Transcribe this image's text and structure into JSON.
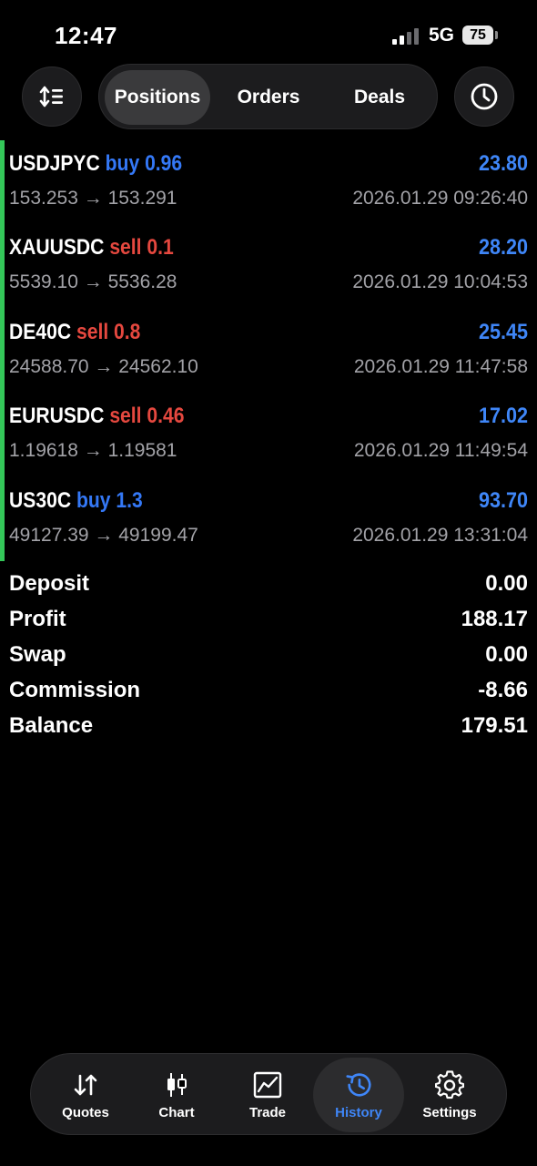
{
  "status_bar": {
    "time": "12:47",
    "network": "5G",
    "battery": "75"
  },
  "header": {
    "sort_icon": "sort-icon",
    "history_icon": "clock-icon",
    "tabs": [
      {
        "label": "Positions",
        "active": true
      },
      {
        "label": "Orders",
        "active": false
      },
      {
        "label": "Deals",
        "active": false
      }
    ]
  },
  "trades": [
    {
      "symbol": "USDJPYC",
      "side": "buy",
      "volume": "0.96",
      "profit": "23.80",
      "prices": "153.253 → 153.291",
      "datetime": "2026.01.29 09:26:40"
    },
    {
      "symbol": "XAUUSDC",
      "side": "sell",
      "volume": "0.1",
      "profit": "28.20",
      "prices": "5539.10 → 5536.28",
      "datetime": "2026.01.29 10:04:53"
    },
    {
      "symbol": "DE40C",
      "side": "sell",
      "volume": "0.8",
      "profit": "25.45",
      "prices": "24588.70 → 24562.10",
      "datetime": "2026.01.29 11:47:58"
    },
    {
      "symbol": "EURUSDC",
      "side": "sell",
      "volume": "0.46",
      "profit": "17.02",
      "prices": "1.19618 → 1.19581",
      "datetime": "2026.01.29 11:49:54"
    },
    {
      "symbol": "US30C",
      "side": "buy",
      "volume": "1.3",
      "profit": "93.70",
      "prices": "49127.39 → 49199.47",
      "datetime": "2026.01.29 13:31:04"
    }
  ],
  "summary": {
    "deposit_label": "Deposit",
    "deposit": "0.00",
    "profit_label": "Profit",
    "profit": "188.17",
    "swap_label": "Swap",
    "swap": "0.00",
    "commission_label": "Commission",
    "commission": "-8.66",
    "balance_label": "Balance",
    "balance": "179.51"
  },
  "tabbar": [
    {
      "label": "Quotes",
      "icon": "quotes-arrows-icon",
      "active": false
    },
    {
      "label": "Chart",
      "icon": "candlestick-icon",
      "active": false
    },
    {
      "label": "Trade",
      "icon": "trade-chart-icon",
      "active": false
    },
    {
      "label": "History",
      "icon": "history-icon",
      "active": true
    },
    {
      "label": "Settings",
      "icon": "gear-icon",
      "active": false
    }
  ],
  "colors": {
    "accent": "#3f86f7",
    "buy": "#3478f6",
    "sell": "#e5483f",
    "position_bar": "#34c759",
    "muted_text": "#a2a2a7"
  }
}
